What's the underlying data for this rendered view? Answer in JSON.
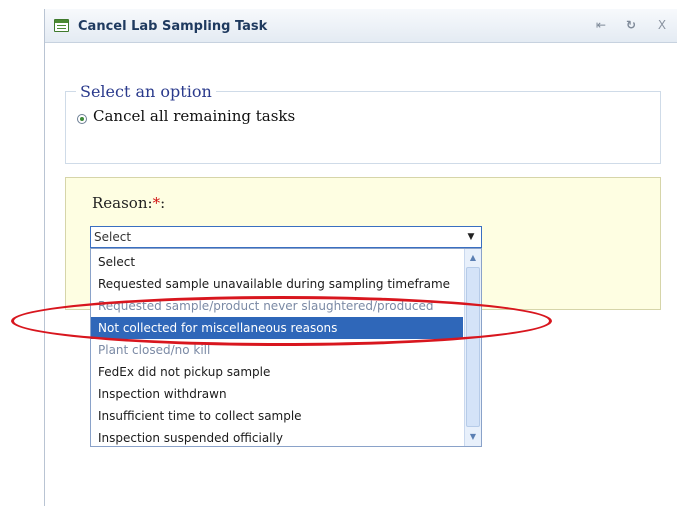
{
  "window": {
    "title": "Cancel Lab Sampling Task",
    "icons": {
      "app": "form-icon",
      "pin": "pin-icon",
      "refresh": "refresh-icon",
      "close": "close-icon"
    },
    "close_label": "X"
  },
  "option_group": {
    "legend": "Select an option",
    "options": [
      {
        "label": "Cancel all remaining tasks",
        "selected": true
      }
    ]
  },
  "reason": {
    "label": "Reason:",
    "required_mark": "*",
    "label_suffix": ":",
    "select_value": "Select",
    "options": [
      "Select",
      "Requested sample unavailable during sampling timeframe",
      "Requested sample/product never slaughtered/produced",
      "Not collected for miscellaneous reasons",
      "Plant closed/no kill",
      "FedEx did not pickup sample",
      "Inspection withdrawn",
      "Insufficient time to collect sample",
      "Inspection suspended officially"
    ],
    "highlighted_index": 3
  },
  "colors": {
    "highlight_ring": "#d8161e",
    "selected_option": "#2f67b9",
    "panel_background": "#fefee2",
    "legend_text": "#2a3a8c"
  }
}
